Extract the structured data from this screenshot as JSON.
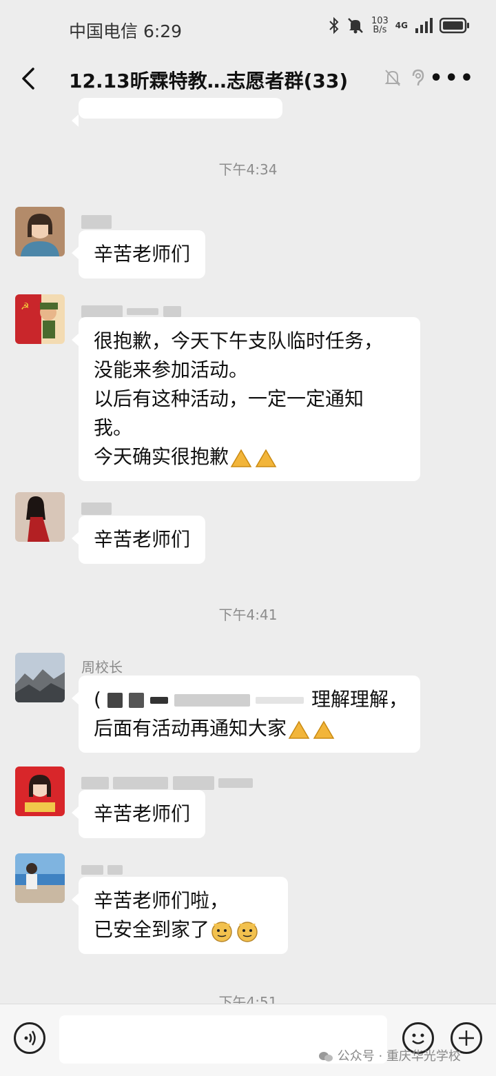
{
  "status_bar": {
    "carrier_time": "中国电信 6:29",
    "speed_value": "103",
    "speed_unit": "B/s",
    "network": "4G"
  },
  "header": {
    "title": "12.13昕霖特教…志愿者群(33)"
  },
  "messages": [
    {
      "time": "下午4:34"
    },
    {
      "sender": "",
      "text": "辛苦老师们"
    },
    {
      "sender": "",
      "lines": [
        "很抱歉，今天下午支队临时任务，",
        "没能来参加活动。",
        "以后有这种活动，一定一定通知",
        "我。",
        "今天确实很抱歉"
      ]
    },
    {
      "sender": "",
      "text": "辛苦老师们"
    },
    {
      "time": "下午4:41"
    },
    {
      "sender": "周校长",
      "lines": [
        "理解理解，",
        "后面有活动再通知大家"
      ]
    },
    {
      "sender": "",
      "text": "辛苦老师们"
    },
    {
      "sender": "",
      "lines": [
        "辛苦老师们啦，",
        "已安全到家了"
      ]
    },
    {
      "time": "下午4:51"
    }
  ],
  "input": {
    "placeholder": ""
  },
  "watermark": "公众号 · 重庆华光学校",
  "colors": {
    "background": "#ededed",
    "bubble": "#ffffff",
    "timestamp": "#8c8c8c"
  }
}
